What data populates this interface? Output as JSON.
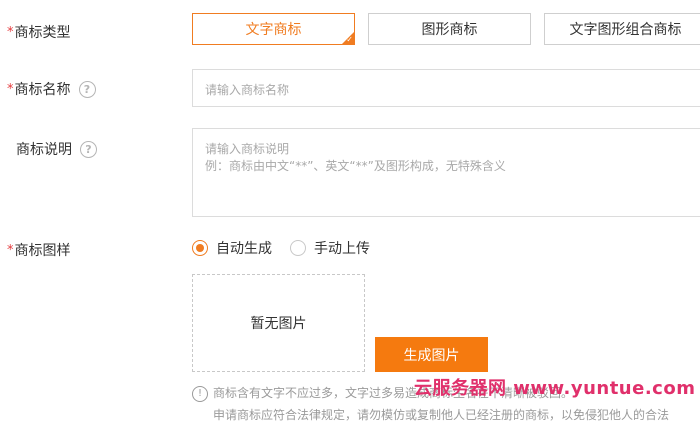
{
  "type_row": {
    "label": "商标类型",
    "required": "*",
    "options": [
      "文字商标",
      "图形商标",
      "文字图形组合商标"
    ]
  },
  "name_row": {
    "label": "商标名称",
    "required": "*",
    "help": "?",
    "placeholder": "请输入商标名称"
  },
  "desc_row": {
    "label": "商标说明",
    "help": "?",
    "placeholder_line1": "请输入商标说明",
    "placeholder_line2": "例：商标由中文“**”、英文“**”及图形构成，无特殊含义"
  },
  "image_row": {
    "label": "商标图样",
    "required": "*",
    "radio_auto": "自动生成",
    "radio_manual": "手动上传",
    "empty_text": "暂无图片",
    "generate_button": "生成图片"
  },
  "notes": {
    "line1": "商标含有文字不应过多，文字过多易造成商标生名在不清晰被驳回。",
    "line2": "申请商标应符合法律规定，请勿模仿或复制他人已经注册的商标，以免侵犯他人的合法"
  },
  "watermark": "云服务器网 www.yuntue.com",
  "colors": {
    "accent": "#f07c21",
    "button": "#f57a0f",
    "required": "#e4393c"
  }
}
